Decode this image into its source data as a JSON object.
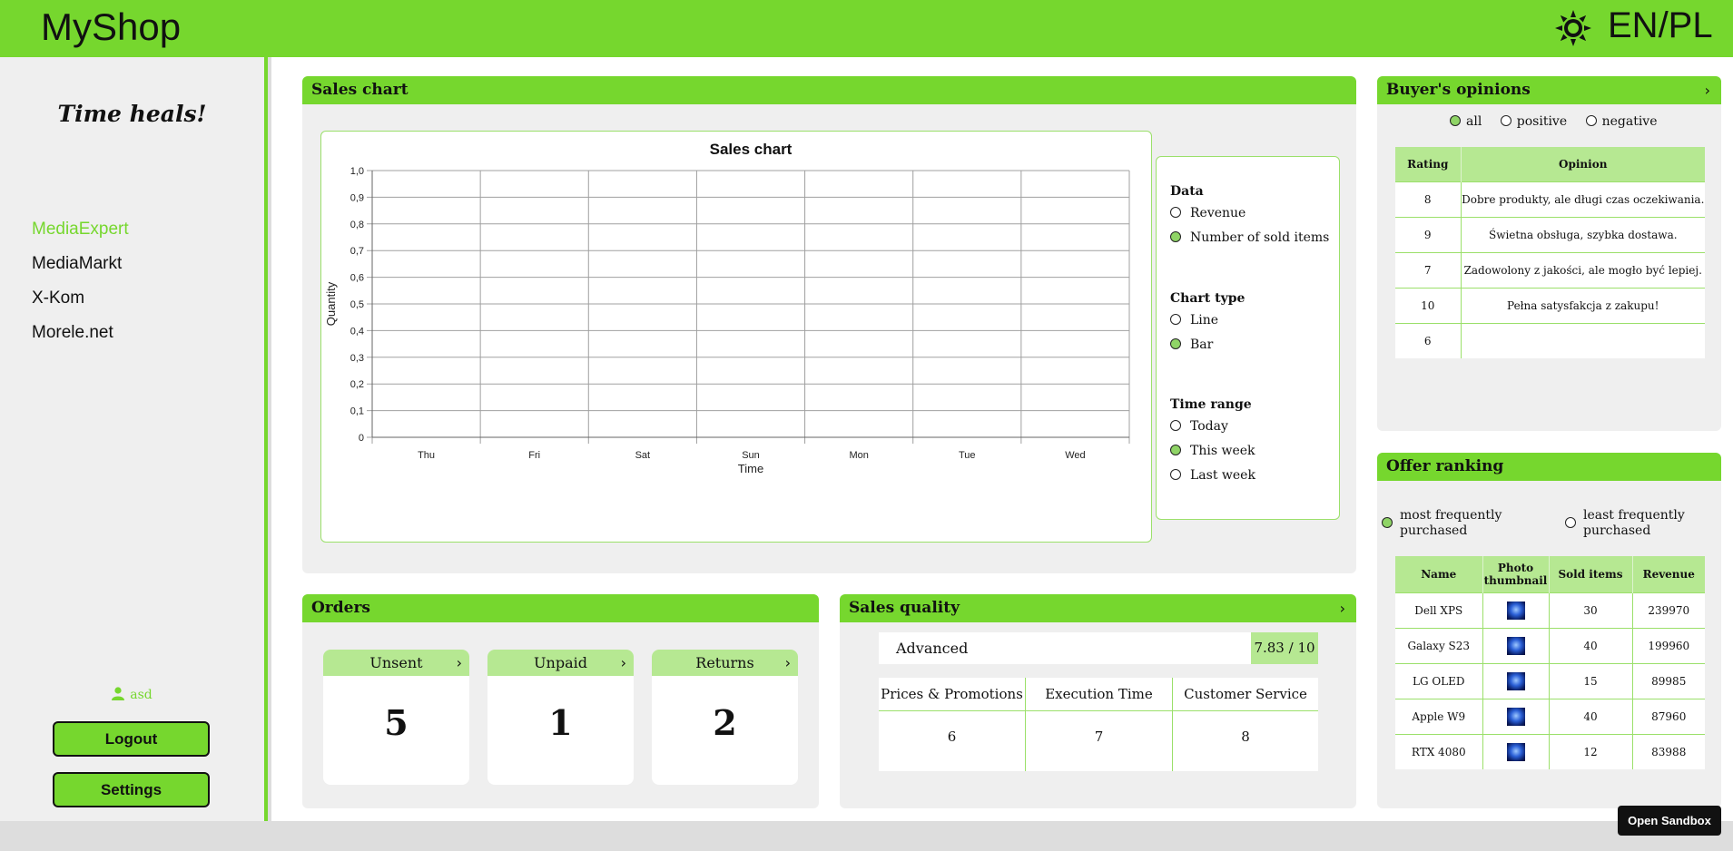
{
  "header": {
    "brand": "MyShop",
    "theme_icon": "sun-icon",
    "language": "EN/PL"
  },
  "sidebar": {
    "tagline": "Time heals!",
    "shops": [
      {
        "label": "MediaExpert",
        "active": true
      },
      {
        "label": "MediaMarkt",
        "active": false
      },
      {
        "label": "X-Kom",
        "active": false
      },
      {
        "label": "Morele.net",
        "active": false
      }
    ],
    "user_name": "asd",
    "logout_label": "Logout",
    "settings_label": "Settings"
  },
  "sales_panel": {
    "title": "Sales chart",
    "data_title": "Data",
    "data_options": [
      {
        "label": "Revenue",
        "selected": false
      },
      {
        "label": "Number of sold items",
        "selected": true
      }
    ],
    "chart_type_title": "Chart type",
    "chart_type_options": [
      {
        "label": "Line",
        "selected": false
      },
      {
        "label": "Bar",
        "selected": true
      }
    ],
    "time_range_title": "Time range",
    "time_range_options": [
      {
        "label": "Today",
        "selected": false
      },
      {
        "label": "This week",
        "selected": true
      },
      {
        "label": "Last week",
        "selected": false
      }
    ]
  },
  "chart_data": {
    "type": "bar",
    "title": "Sales chart",
    "xlabel": "Time",
    "ylabel": "Quantity",
    "categories": [
      "Thu",
      "Fri",
      "Sat",
      "Sun",
      "Mon",
      "Tue",
      "Wed"
    ],
    "values": [
      0,
      0,
      0,
      0,
      0,
      0,
      0
    ],
    "ylim": [
      0,
      1
    ],
    "yticks": [
      "0",
      "0,1",
      "0,2",
      "0,3",
      "0,4",
      "0,5",
      "0,6",
      "0,7",
      "0,8",
      "0,9",
      "1,0"
    ],
    "grid": true
  },
  "opinions": {
    "title": "Buyer's opinions",
    "filters": [
      {
        "label": "all",
        "selected": true
      },
      {
        "label": "positive",
        "selected": false
      },
      {
        "label": "negative",
        "selected": false
      }
    ],
    "columns": [
      "Rating",
      "Opinion"
    ],
    "rows": [
      {
        "rating": "8",
        "opinion": "Dobre produkty, ale długi czas oczekiwania."
      },
      {
        "rating": "9",
        "opinion": "Świetna obsługa, szybka dostawa."
      },
      {
        "rating": "7",
        "opinion": "Zadowolony z jakości, ale mogło być lepiej."
      },
      {
        "rating": "10",
        "opinion": "Pełna satysfakcja z zakupu!"
      },
      {
        "rating": "6",
        "opinion": ""
      }
    ]
  },
  "ranking": {
    "title": "Offer ranking",
    "filters": [
      {
        "label": "most frequently purchased",
        "selected": true
      },
      {
        "label": "least frequently purchased",
        "selected": false
      }
    ],
    "columns": [
      "Name",
      "Photo thumbnail",
      "Sold items",
      "Revenue"
    ],
    "rows": [
      {
        "name": "Dell XPS",
        "sold": "30",
        "revenue": "239970"
      },
      {
        "name": "Galaxy S23",
        "sold": "40",
        "revenue": "199960"
      },
      {
        "name": "LG OLED",
        "sold": "15",
        "revenue": "89985"
      },
      {
        "name": "Apple W9",
        "sold": "40",
        "revenue": "87960"
      },
      {
        "name": "RTX 4080",
        "sold": "12",
        "revenue": "83988"
      }
    ]
  },
  "orders": {
    "title": "Orders",
    "cards": [
      {
        "label": "Unsent",
        "value": "5"
      },
      {
        "label": "Unpaid",
        "value": "1"
      },
      {
        "label": "Returns",
        "value": "2"
      }
    ]
  },
  "quality": {
    "title": "Sales quality",
    "level": "Advanced",
    "score": "7.83 / 10",
    "categories": [
      {
        "label": "Prices & Promotions",
        "value": "6"
      },
      {
        "label": "Execution Time",
        "value": "7"
      },
      {
        "label": "Customer Service",
        "value": "8"
      }
    ]
  },
  "footer": {
    "sandbox_label": "Open Sandbox"
  },
  "colors": {
    "accent": "#76d72e",
    "accent_light": "#b6e892",
    "panel_bg": "#efefef"
  }
}
